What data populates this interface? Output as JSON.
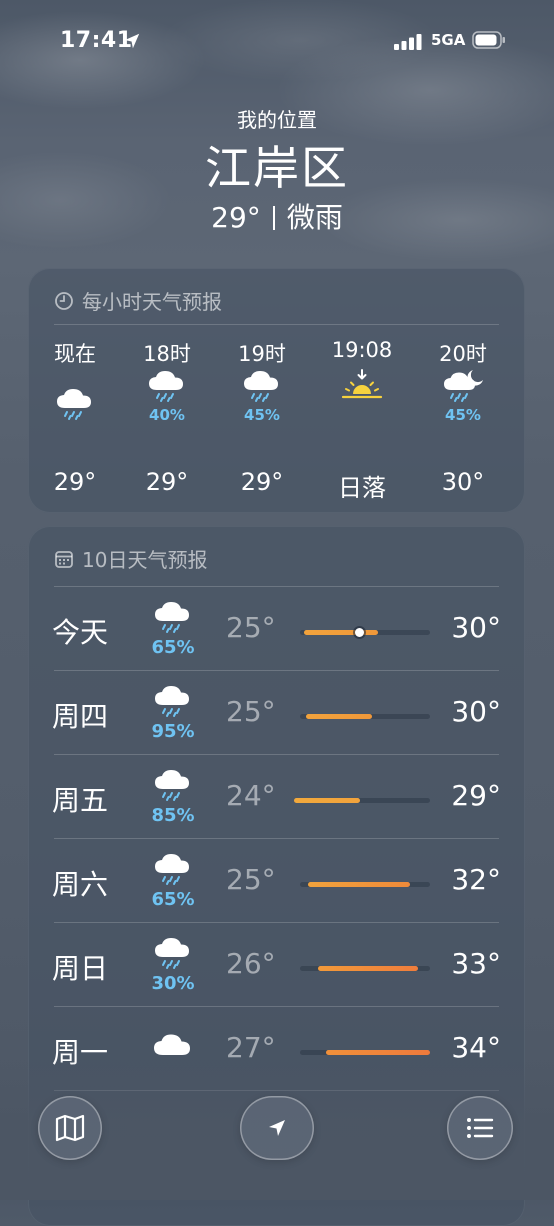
{
  "status_bar": {
    "time": "17:41",
    "network": "5GA"
  },
  "header": {
    "subtitle": "我的位置",
    "city": "江岸区",
    "temp": "29°",
    "condition": "微雨"
  },
  "hourly": {
    "title": "每小时天气预报",
    "items": [
      {
        "label": "现在",
        "icon": "cloud-rain-icon",
        "precip": "",
        "temp": "29°"
      },
      {
        "label": "18时",
        "icon": "cloud-rain-icon",
        "precip": "40%",
        "temp": "29°"
      },
      {
        "label": "19时",
        "icon": "cloud-rain-icon",
        "precip": "45%",
        "temp": "29°"
      },
      {
        "label": "19:08",
        "icon": "sunset-icon",
        "precip": "",
        "temp": "日落"
      },
      {
        "label": "20时",
        "icon": "cloud-moon-rain-icon",
        "precip": "45%",
        "temp": "30°"
      }
    ]
  },
  "daily": {
    "title": "10日天气预报",
    "items": [
      {
        "day": "今天",
        "icon": "cloud-rain-icon",
        "precip": "65%",
        "low": "25°",
        "high": "30°"
      },
      {
        "day": "周四",
        "icon": "cloud-rain-icon",
        "precip": "95%",
        "low": "25°",
        "high": "30°"
      },
      {
        "day": "周五",
        "icon": "cloud-rain-icon",
        "precip": "85%",
        "low": "24°",
        "high": "29°"
      },
      {
        "day": "周六",
        "icon": "cloud-rain-icon",
        "precip": "65%",
        "low": "25°",
        "high": "32°"
      },
      {
        "day": "周日",
        "icon": "cloud-rain-icon",
        "precip": "30%",
        "low": "26°",
        "high": "33°"
      },
      {
        "day": "周一",
        "icon": "cloud-icon",
        "precip": "",
        "low": "27°",
        "high": "34°"
      }
    ]
  },
  "colors": {
    "precip_blue": "#6fc3f2",
    "bar_warm": "#f2a33c",
    "bar_hot": "#ef7d3c",
    "sun_yellow": "#f7d23e"
  }
}
